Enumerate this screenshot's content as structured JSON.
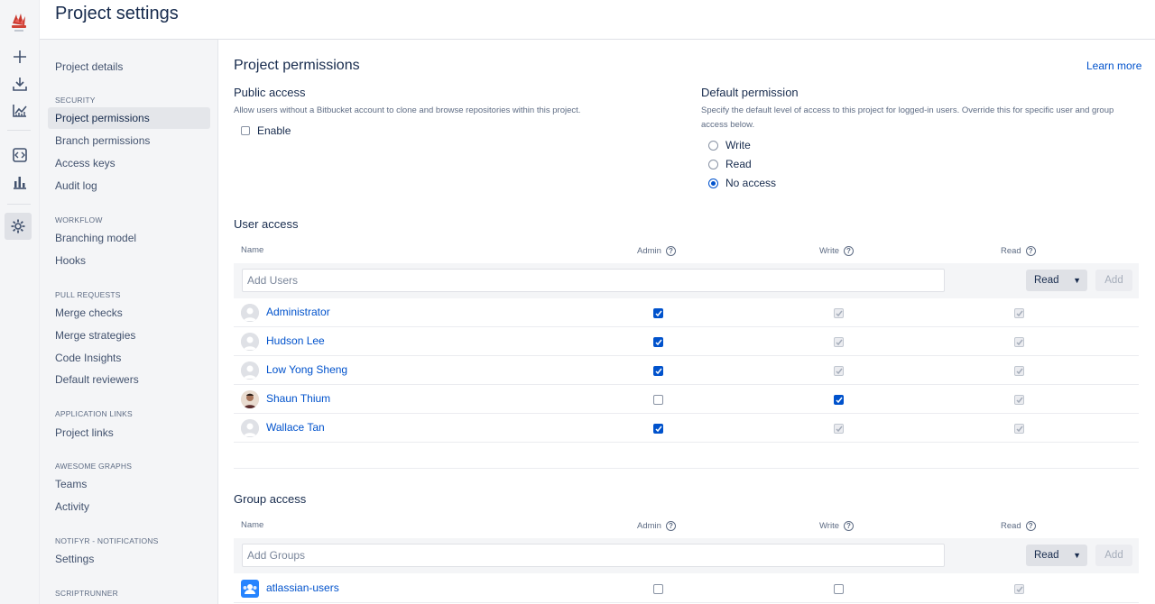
{
  "header": {
    "title": "Project settings"
  },
  "sidebar": {
    "items_top": [
      {
        "label": "Project details"
      }
    ],
    "sections": [
      {
        "heading": "SECURITY",
        "items": [
          "Project permissions",
          "Branch permissions",
          "Access keys",
          "Audit log"
        ]
      },
      {
        "heading": "WORKFLOW",
        "items": [
          "Branching model",
          "Hooks"
        ]
      },
      {
        "heading": "PULL REQUESTS",
        "items": [
          "Merge checks",
          "Merge strategies",
          "Code Insights",
          "Default reviewers"
        ]
      },
      {
        "heading": "APPLICATION LINKS",
        "items": [
          "Project links"
        ]
      },
      {
        "heading": "AWESOME GRAPHS",
        "items": [
          "Teams",
          "Activity"
        ]
      },
      {
        "heading": "NOTIFYR - NOTIFICATIONS",
        "items": [
          "Settings"
        ]
      },
      {
        "heading": "SCRIPTRUNNER",
        "items": []
      }
    ],
    "active": "Project permissions"
  },
  "main": {
    "title": "Project permissions",
    "learn_more": "Learn more",
    "public_access": {
      "title": "Public access",
      "description": "Allow users without a Bitbucket account to clone and browse repositories within this project.",
      "enable_label": "Enable",
      "enabled": false
    },
    "default_permission": {
      "title": "Default permission",
      "description_line1": "Specify the default level of access to this project for logged-in users. Override this for specific user and group",
      "description_line2": "access below.",
      "options": [
        "Write",
        "Read",
        "No access"
      ],
      "selected": "No access"
    },
    "columns": {
      "name": "Name",
      "admin": "Admin",
      "write": "Write",
      "read": "Read"
    },
    "user_access": {
      "title": "User access",
      "placeholder": "Add Users",
      "select_value": "Read",
      "add_label": "Add",
      "rows": [
        {
          "name": "Administrator",
          "admin": true,
          "write": "implied",
          "read": "implied"
        },
        {
          "name": "Hudson Lee",
          "admin": true,
          "write": "implied",
          "read": "implied"
        },
        {
          "name": "Low Yong Sheng",
          "admin": true,
          "write": "implied",
          "read": "implied"
        },
        {
          "name": "Shaun Thium",
          "admin": false,
          "write": true,
          "read": "implied"
        },
        {
          "name": "Wallace Tan",
          "admin": true,
          "write": "implied",
          "read": "implied"
        }
      ]
    },
    "group_access": {
      "title": "Group access",
      "placeholder": "Add Groups",
      "select_value": "Read",
      "add_label": "Add",
      "rows": [
        {
          "name": "atlassian-users",
          "admin": false,
          "write": false,
          "read": "implied"
        }
      ]
    }
  },
  "colors": {
    "accent": "#0052cc",
    "sidebar_bg": "#f4f5f7",
    "text": "#172b4d"
  }
}
